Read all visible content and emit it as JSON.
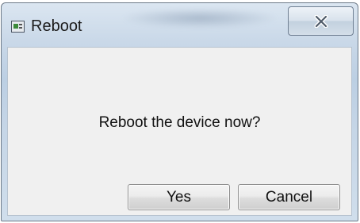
{
  "window": {
    "title": "Reboot",
    "icon": "app-window-icon",
    "close_icon": "close-icon"
  },
  "dialog": {
    "message": "Reboot the device now?",
    "yes_label": "Yes",
    "cancel_label": "Cancel"
  },
  "colors": {
    "titlebar": "#c6d6e7",
    "content_bg": "#f0f0f0",
    "button_border": "#8f8f8f"
  }
}
